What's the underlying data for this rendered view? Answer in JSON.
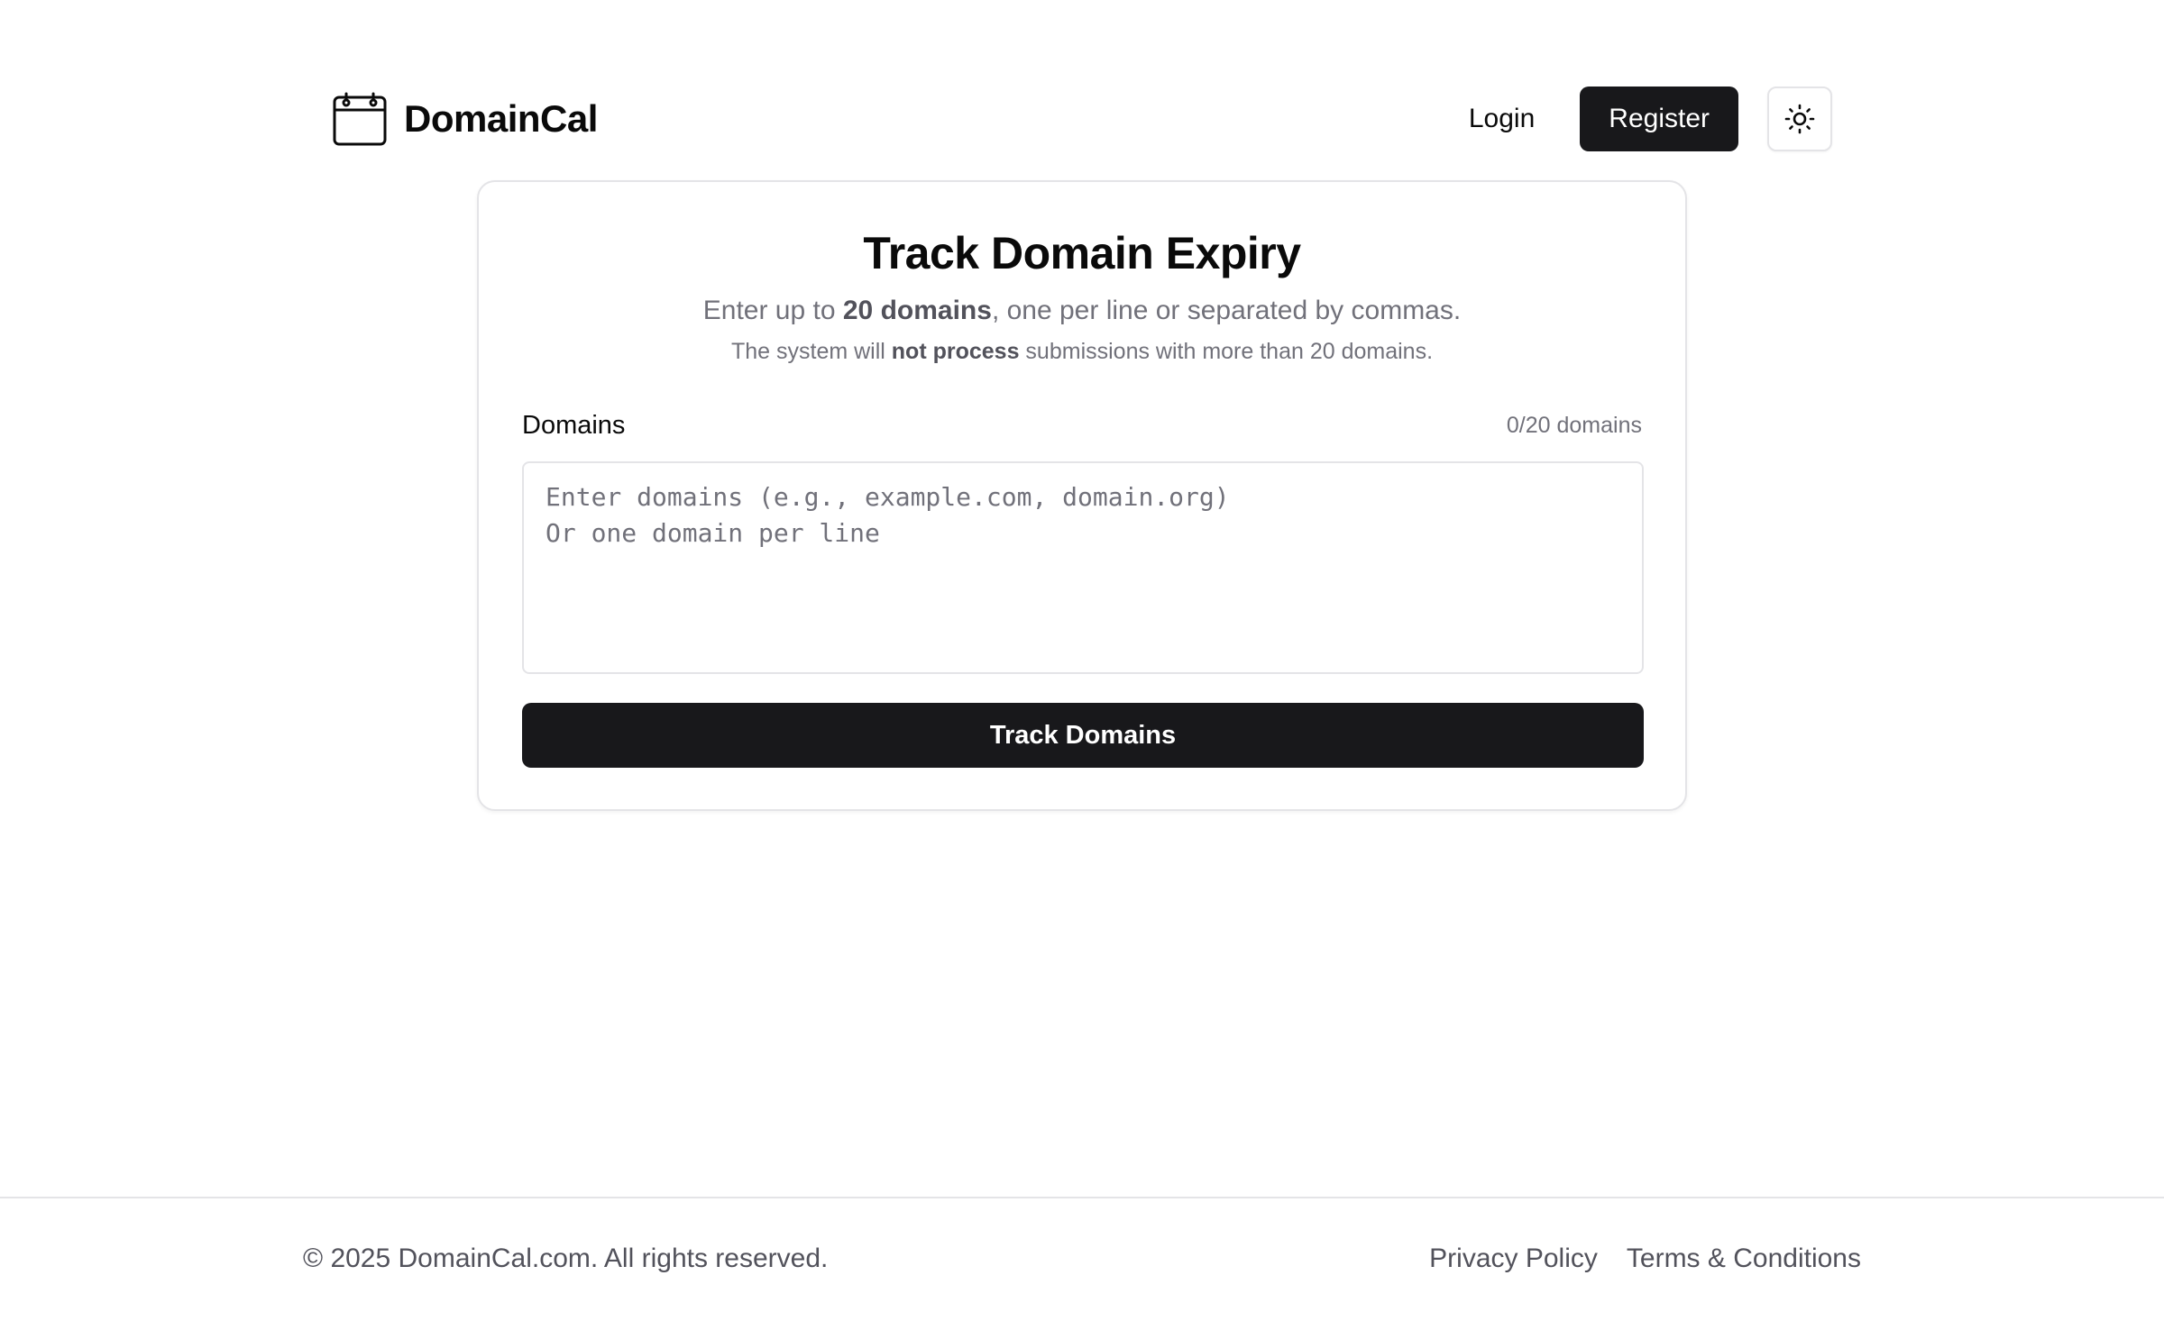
{
  "brand": {
    "name": "DomainCal",
    "icon": "calendar-icon"
  },
  "nav": {
    "login_label": "Login",
    "register_label": "Register",
    "theme_icon": "sun-icon"
  },
  "tracker": {
    "title": "Track Domain Expiry",
    "subtitle_prefix": "Enter up to ",
    "subtitle_bold": "20 domains",
    "subtitle_suffix": ", one per line or separated by commas.",
    "note_prefix": "The system will ",
    "note_bold": "not process",
    "note_suffix": " submissions with more than 20 domains.",
    "field_label": "Domains",
    "count_text": "0/20 domains",
    "textarea_value": "",
    "textarea_placeholder": "Enter domains (e.g., example.com, domain.org)\nOr one domain per line",
    "submit_label": "Track Domains"
  },
  "footer": {
    "copyright": "© 2025 DomainCal.com. All rights reserved.",
    "links": [
      {
        "label": "Privacy Policy"
      },
      {
        "label": "Terms & Conditions"
      }
    ]
  },
  "colors": {
    "primary": "#18181b",
    "muted_text": "#71717a",
    "border": "#e4e4e7",
    "background": "#ffffff"
  }
}
